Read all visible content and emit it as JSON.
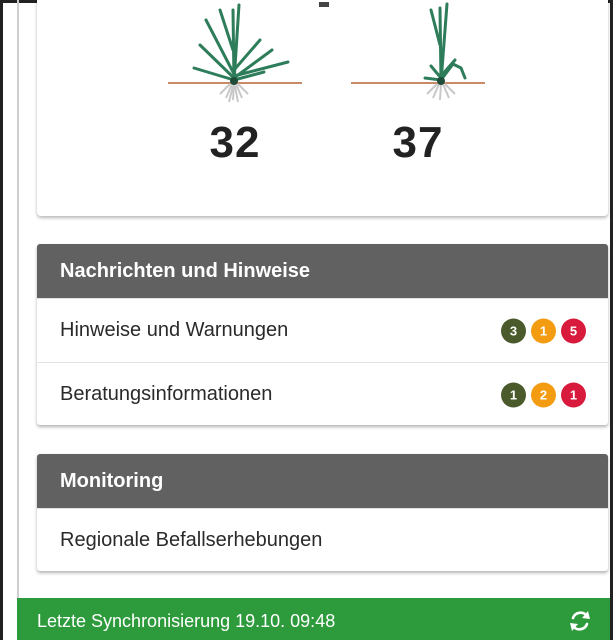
{
  "growth_stages": [
    {
      "value": "32",
      "icon": "plant-stage-icon"
    },
    {
      "value": "37",
      "icon": "plant-stage-icon"
    }
  ],
  "news_section": {
    "title": "Nachrichten und Hinweise",
    "rows": [
      {
        "label": "Hinweise und Warnungen",
        "badges": [
          {
            "count": "3",
            "color": "#4a5a2a"
          },
          {
            "count": "1",
            "color": "#f39c12"
          },
          {
            "count": "5",
            "color": "#d81b3c"
          }
        ]
      },
      {
        "label": "Beratungsinformationen",
        "badges": [
          {
            "count": "1",
            "color": "#4a5a2a"
          },
          {
            "count": "2",
            "color": "#f39c12"
          },
          {
            "count": "1",
            "color": "#d81b3c"
          }
        ]
      }
    ]
  },
  "monitoring_section": {
    "title": "Monitoring",
    "rows": [
      {
        "label": "Regionale Befallserhebungen"
      }
    ]
  },
  "sync_bar": {
    "text": "Letzte Synchronisierung 19.10. 09:48",
    "icon": "sync-icon",
    "color": "#2d9a3c"
  }
}
